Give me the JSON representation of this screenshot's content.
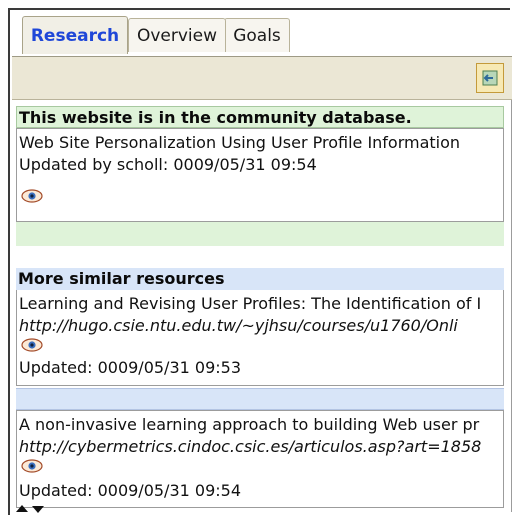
{
  "tabs": [
    {
      "label": "Research",
      "active": true
    },
    {
      "label": "Overview",
      "active": false
    },
    {
      "label": "Goals",
      "active": false
    }
  ],
  "toolbar": {
    "icon": "back-arrow-icon"
  },
  "community": {
    "header": "This website is in the community database.",
    "title": "Web Site Personalization Using User Profile Information",
    "updated": "Updated by scholl: 0009/05/31 09:54",
    "icon": "eye-icon"
  },
  "similar": {
    "header": "More similar resources",
    "items": [
      {
        "title": "Learning and Revising User Profiles: The Identification of I",
        "url": "http://hugo.csie.ntu.edu.tw/~yjhsu/courses/u1760/Onli",
        "updated": "Updated: 0009/05/31 09:53",
        "icon": "eye-icon"
      },
      {
        "title": "A non-invasive learning approach to building Web user pr",
        "url": "http://cybermetrics.cindoc.csic.es/articulos.asp?art=1858",
        "updated": "Updated: 0009/05/31 09:54",
        "icon": "eye-icon"
      }
    ]
  },
  "colors": {
    "active_tab_text": "#1f47d8",
    "green_header": "#dff3d9",
    "blue_header": "#d8e5f8",
    "toolbar": "#ebe7d5"
  }
}
